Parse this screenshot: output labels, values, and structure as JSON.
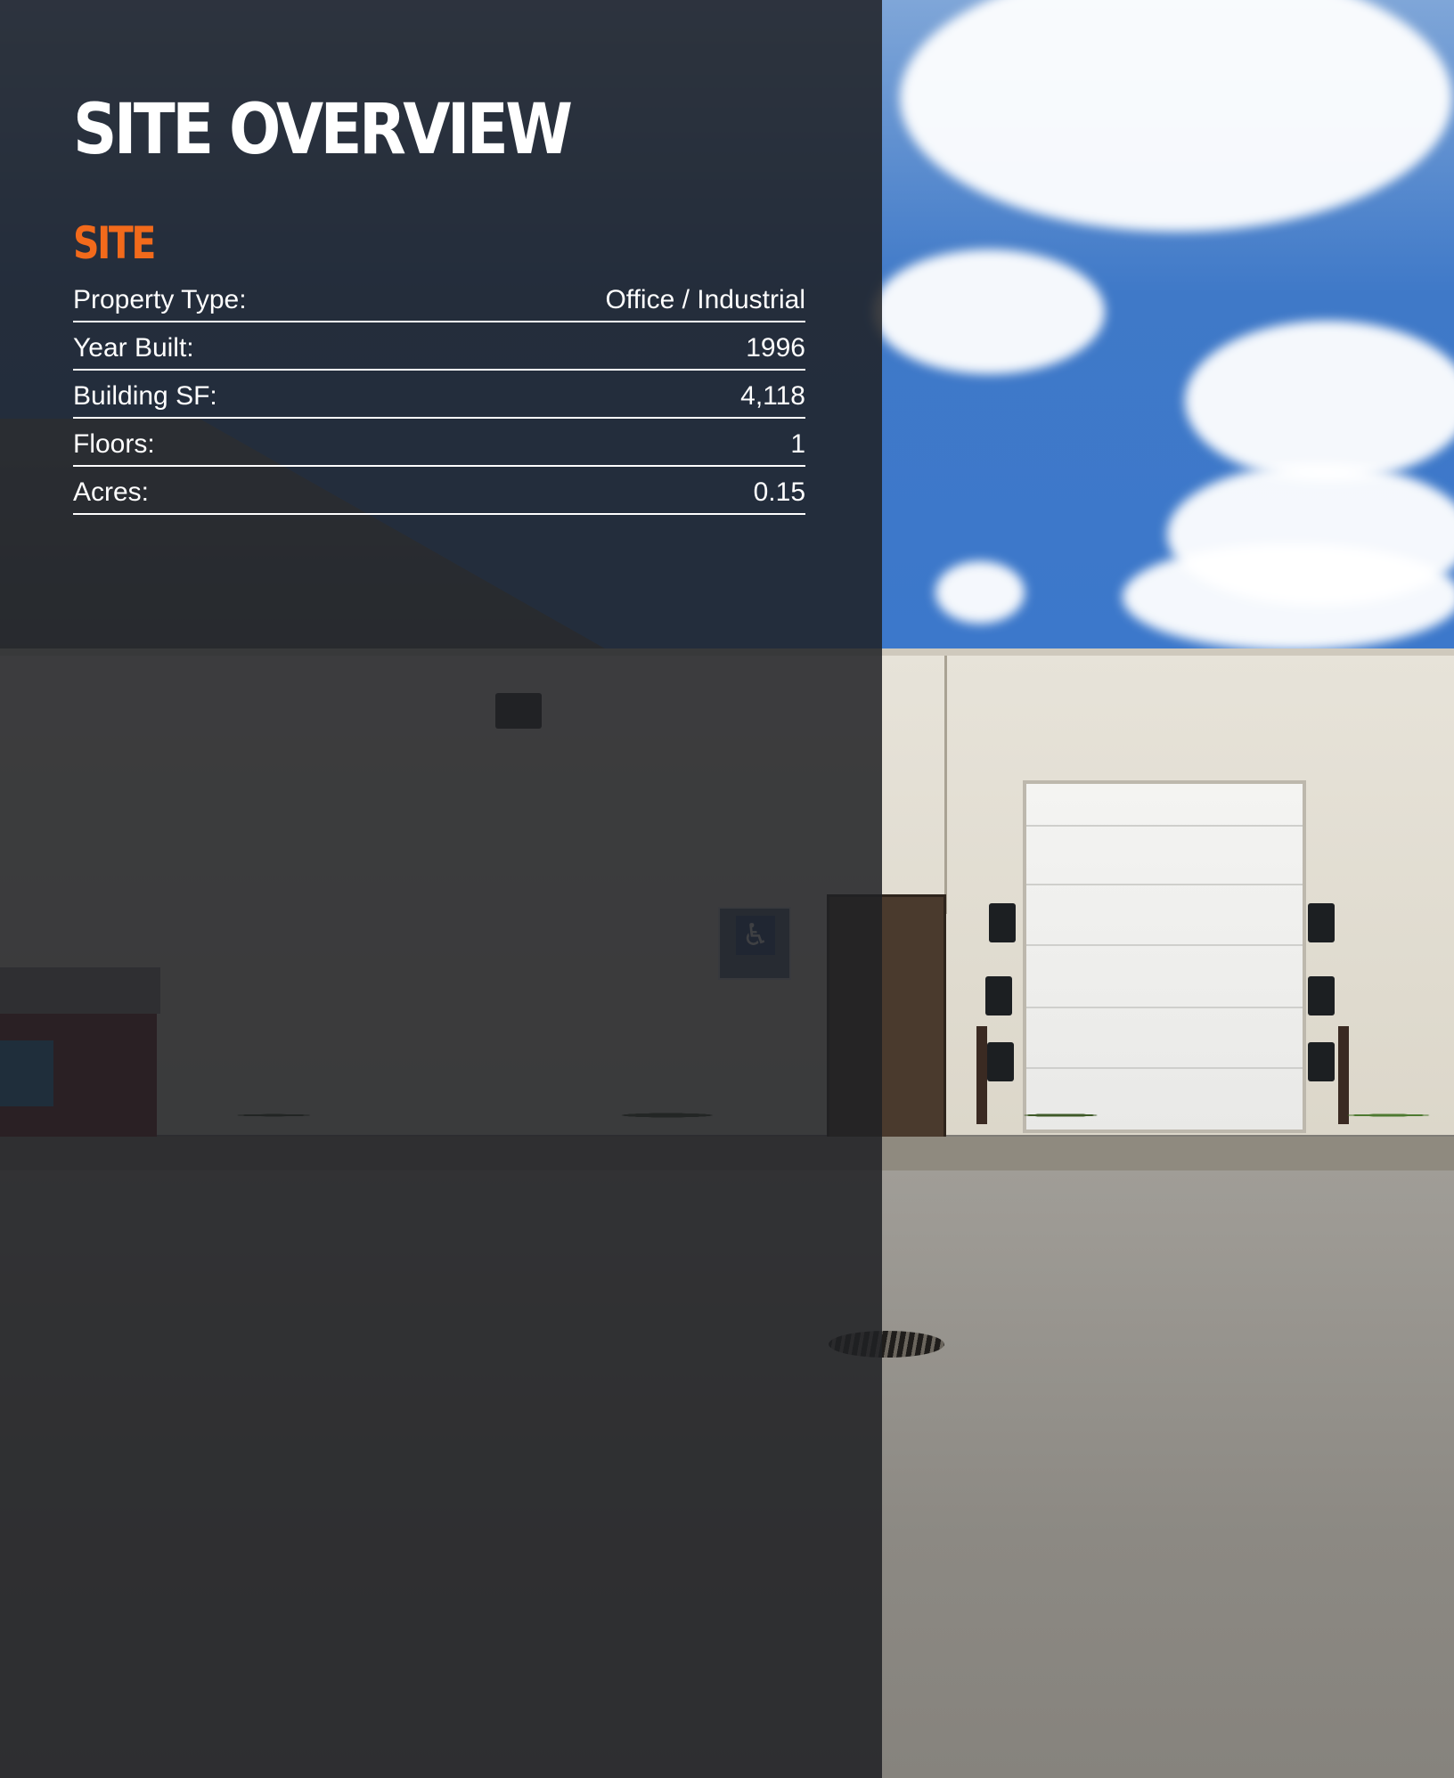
{
  "title": "SITE OVERVIEW",
  "section": "SITE",
  "specs": [
    {
      "label": "Property Type:",
      "value": "Office / Industrial"
    },
    {
      "label": "Year Built:",
      "value": "1996"
    },
    {
      "label": "Building SF:",
      "value": "4,118"
    },
    {
      "label": "Floors:",
      "value": "1"
    },
    {
      "label": "Acres:",
      "value": "0.15"
    }
  ],
  "colors": {
    "accent": "#f26a1b",
    "overlay": "#202124",
    "text": "#ffffff"
  },
  "icons": {
    "accessibility_sign": "wheelchair-icon"
  }
}
